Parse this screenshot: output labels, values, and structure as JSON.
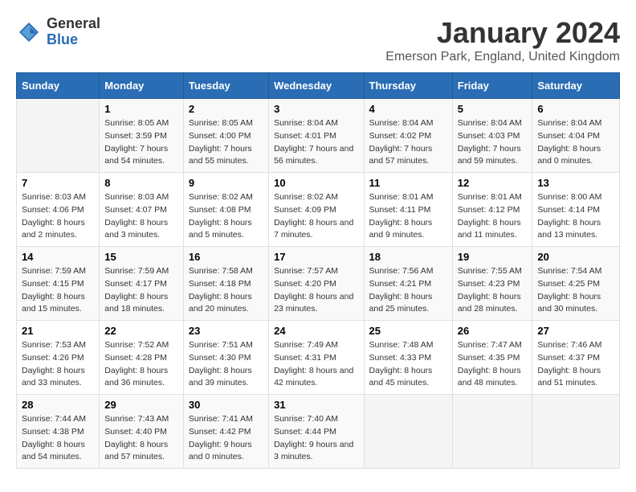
{
  "logo": {
    "general": "General",
    "blue": "Blue"
  },
  "header": {
    "month": "January 2024",
    "location": "Emerson Park, England, United Kingdom"
  },
  "weekdays": [
    "Sunday",
    "Monday",
    "Tuesday",
    "Wednesday",
    "Thursday",
    "Friday",
    "Saturday"
  ],
  "weeks": [
    [
      {
        "day": "",
        "empty": true
      },
      {
        "day": "1",
        "sunrise": "8:05 AM",
        "sunset": "3:59 PM",
        "daylight": "7 hours and 54 minutes."
      },
      {
        "day": "2",
        "sunrise": "8:05 AM",
        "sunset": "4:00 PM",
        "daylight": "7 hours and 55 minutes."
      },
      {
        "day": "3",
        "sunrise": "8:04 AM",
        "sunset": "4:01 PM",
        "daylight": "7 hours and 56 minutes."
      },
      {
        "day": "4",
        "sunrise": "8:04 AM",
        "sunset": "4:02 PM",
        "daylight": "7 hours and 57 minutes."
      },
      {
        "day": "5",
        "sunrise": "8:04 AM",
        "sunset": "4:03 PM",
        "daylight": "7 hours and 59 minutes."
      },
      {
        "day": "6",
        "sunrise": "8:04 AM",
        "sunset": "4:04 PM",
        "daylight": "8 hours and 0 minutes."
      }
    ],
    [
      {
        "day": "7",
        "sunrise": "8:03 AM",
        "sunset": "4:06 PM",
        "daylight": "8 hours and 2 minutes."
      },
      {
        "day": "8",
        "sunrise": "8:03 AM",
        "sunset": "4:07 PM",
        "daylight": "8 hours and 3 minutes."
      },
      {
        "day": "9",
        "sunrise": "8:02 AM",
        "sunset": "4:08 PM",
        "daylight": "8 hours and 5 minutes."
      },
      {
        "day": "10",
        "sunrise": "8:02 AM",
        "sunset": "4:09 PM",
        "daylight": "8 hours and 7 minutes."
      },
      {
        "day": "11",
        "sunrise": "8:01 AM",
        "sunset": "4:11 PM",
        "daylight": "8 hours and 9 minutes."
      },
      {
        "day": "12",
        "sunrise": "8:01 AM",
        "sunset": "4:12 PM",
        "daylight": "8 hours and 11 minutes."
      },
      {
        "day": "13",
        "sunrise": "8:00 AM",
        "sunset": "4:14 PM",
        "daylight": "8 hours and 13 minutes."
      }
    ],
    [
      {
        "day": "14",
        "sunrise": "7:59 AM",
        "sunset": "4:15 PM",
        "daylight": "8 hours and 15 minutes."
      },
      {
        "day": "15",
        "sunrise": "7:59 AM",
        "sunset": "4:17 PM",
        "daylight": "8 hours and 18 minutes."
      },
      {
        "day": "16",
        "sunrise": "7:58 AM",
        "sunset": "4:18 PM",
        "daylight": "8 hours and 20 minutes."
      },
      {
        "day": "17",
        "sunrise": "7:57 AM",
        "sunset": "4:20 PM",
        "daylight": "8 hours and 23 minutes."
      },
      {
        "day": "18",
        "sunrise": "7:56 AM",
        "sunset": "4:21 PM",
        "daylight": "8 hours and 25 minutes."
      },
      {
        "day": "19",
        "sunrise": "7:55 AM",
        "sunset": "4:23 PM",
        "daylight": "8 hours and 28 minutes."
      },
      {
        "day": "20",
        "sunrise": "7:54 AM",
        "sunset": "4:25 PM",
        "daylight": "8 hours and 30 minutes."
      }
    ],
    [
      {
        "day": "21",
        "sunrise": "7:53 AM",
        "sunset": "4:26 PM",
        "daylight": "8 hours and 33 minutes."
      },
      {
        "day": "22",
        "sunrise": "7:52 AM",
        "sunset": "4:28 PM",
        "daylight": "8 hours and 36 minutes."
      },
      {
        "day": "23",
        "sunrise": "7:51 AM",
        "sunset": "4:30 PM",
        "daylight": "8 hours and 39 minutes."
      },
      {
        "day": "24",
        "sunrise": "7:49 AM",
        "sunset": "4:31 PM",
        "daylight": "8 hours and 42 minutes."
      },
      {
        "day": "25",
        "sunrise": "7:48 AM",
        "sunset": "4:33 PM",
        "daylight": "8 hours and 45 minutes."
      },
      {
        "day": "26",
        "sunrise": "7:47 AM",
        "sunset": "4:35 PM",
        "daylight": "8 hours and 48 minutes."
      },
      {
        "day": "27",
        "sunrise": "7:46 AM",
        "sunset": "4:37 PM",
        "daylight": "8 hours and 51 minutes."
      }
    ],
    [
      {
        "day": "28",
        "sunrise": "7:44 AM",
        "sunset": "4:38 PM",
        "daylight": "8 hours and 54 minutes."
      },
      {
        "day": "29",
        "sunrise": "7:43 AM",
        "sunset": "4:40 PM",
        "daylight": "8 hours and 57 minutes."
      },
      {
        "day": "30",
        "sunrise": "7:41 AM",
        "sunset": "4:42 PM",
        "daylight": "9 hours and 0 minutes."
      },
      {
        "day": "31",
        "sunrise": "7:40 AM",
        "sunset": "4:44 PM",
        "daylight": "9 hours and 3 minutes."
      },
      {
        "day": "",
        "empty": true
      },
      {
        "day": "",
        "empty": true
      },
      {
        "day": "",
        "empty": true
      }
    ]
  ]
}
